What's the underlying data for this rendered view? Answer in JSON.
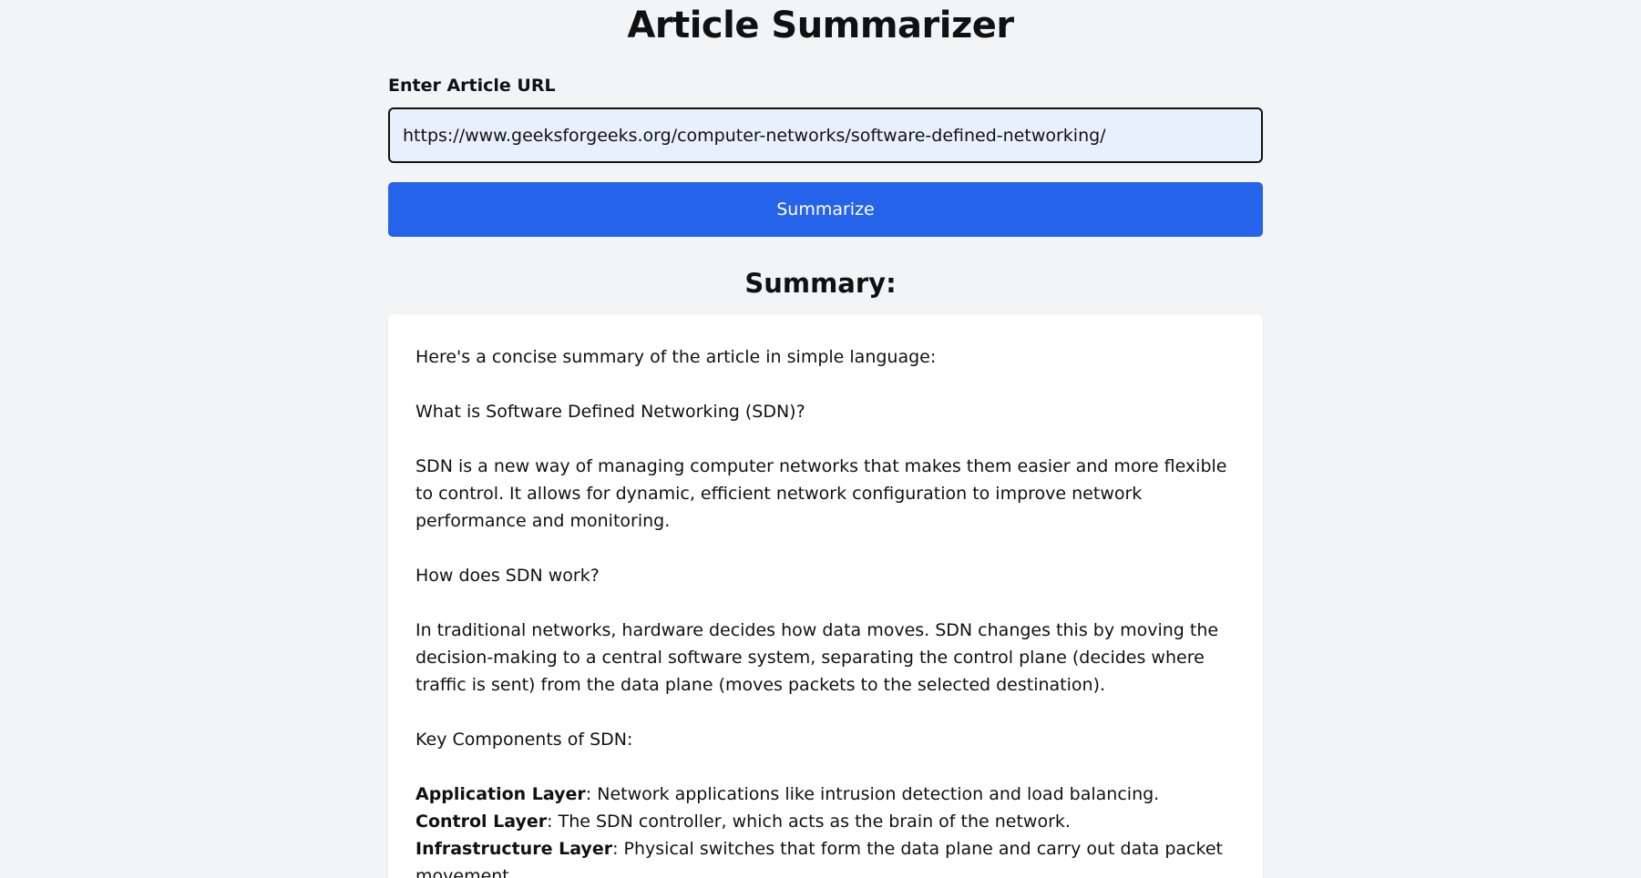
{
  "page": {
    "title": "Article Summarizer"
  },
  "form": {
    "url_label": "Enter Article URL",
    "url_value": "https://www.geeksforgeeks.org/computer-networks/software-defined-networking/",
    "submit_label": "Summarize"
  },
  "summary": {
    "heading": "Summary:",
    "intro": "Here's a concise summary of the article in simple language:",
    "q1": "What is Software Defined Networking (SDN)?",
    "a1": "SDN is a new way of managing computer networks that makes them easier and more flexible to control. It allows for dynamic, efficient network configuration to improve network performance and monitoring.",
    "q2": "How does SDN work?",
    "a2": "In traditional networks, hardware decides how data moves. SDN changes this by moving the decision-making to a central software system, separating the control plane (decides where traffic is sent) from the data plane (moves packets to the selected destination).",
    "components_heading": "Key Components of SDN:",
    "components": [
      {
        "name": "Application Layer",
        "desc": ": Network applications like intrusion detection and load balancing."
      },
      {
        "name": "Control Layer",
        "desc": ": The SDN controller, which acts as the brain of the network."
      },
      {
        "name": "Infrastructure Layer",
        "desc": ": Physical switches that form the data plane and carry out data packet movement."
      }
    ]
  },
  "colors": {
    "background": "#f3f4f6",
    "button": "#2563eb",
    "input_background": "#e8f0fe"
  }
}
